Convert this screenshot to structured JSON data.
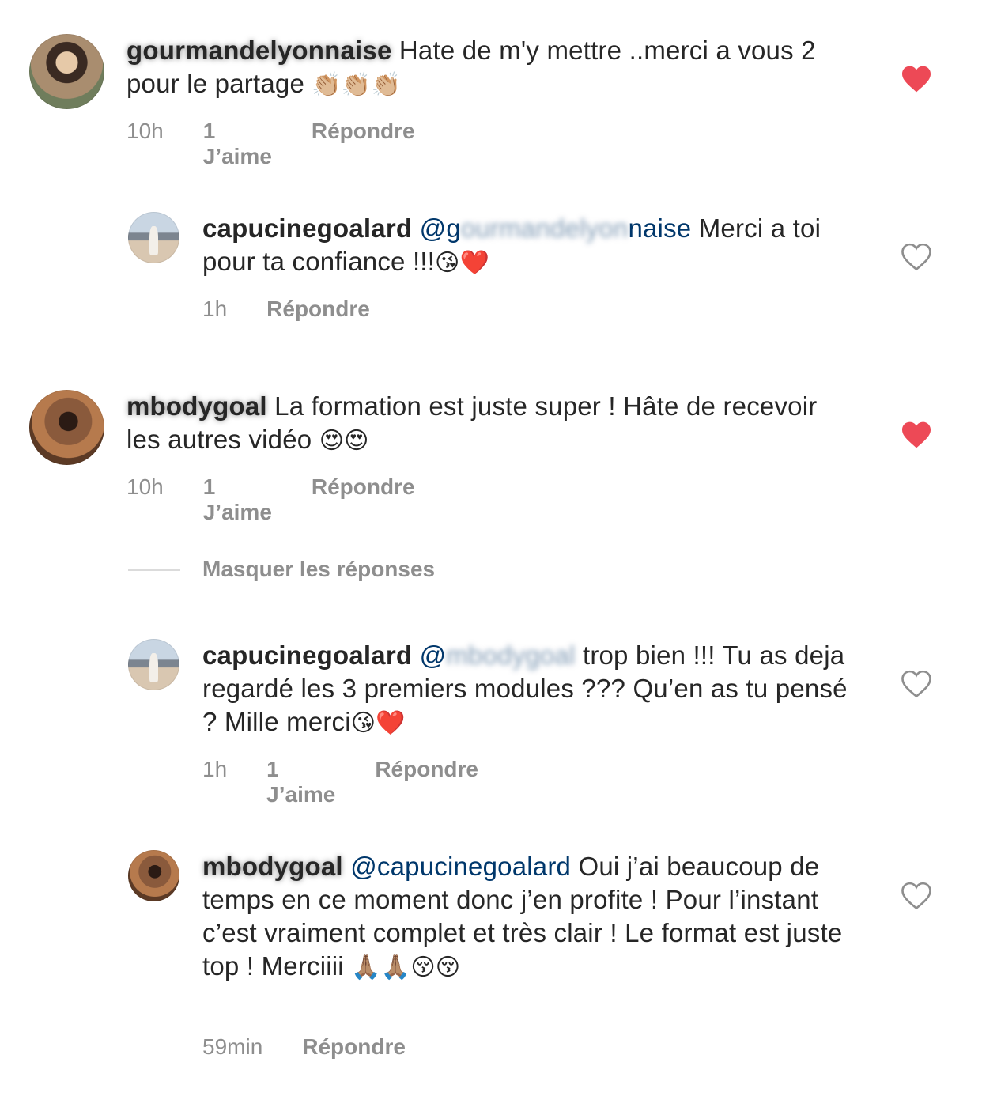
{
  "comments": [
    {
      "username": "gourmandelyonnaise",
      "text": " Hate de m'y mettre ..merci a vous 2 pour le partage ",
      "emojis": "👏🏼👏🏼👏🏼",
      "time": "10h",
      "likes": "1 J’aime",
      "reply": "Répondre",
      "liked": true
    },
    {
      "username": "capucinegoalard",
      "mention_prefix": "@g",
      "mention_hidden": "ourmandelyon",
      "mention_suffix": "naise",
      "text": " Merci a toi pour ta confiance !!!",
      "emojis": "😘❤️",
      "time": "1h",
      "reply": "Répondre",
      "liked": false
    },
    {
      "username": "mbodygoal",
      "text": " La formation est juste super ! Hâte de recevoir les autres vidéo ",
      "emojis": "😍😍",
      "time": "10h",
      "likes": "1 J’aime",
      "reply": "Répondre",
      "liked": true
    },
    {
      "username": "capucinegoalard",
      "mention_prefix": "@",
      "mention_hidden": "mbodygoal",
      "text": " trop bien !!! Tu as deja regardé les 3 premiers modules ??? Qu’en as tu pensé ? Mille merci",
      "emojis": "😘❤️",
      "time": "1h",
      "likes": "1 J’aime",
      "reply": "Répondre",
      "liked": false
    },
    {
      "username": "mbodygoal",
      "mention": "@capucinegoalard",
      "text": " Oui j’ai beaucoup de temps en ce moment donc j’en profite ! Pour l’instant c’est vraiment complet et très clair ! Le format est juste top ! Merciiii ",
      "emojis": "🙏🏽🙏🏽😚😚",
      "time": "59min",
      "reply": "Répondre",
      "liked": false
    }
  ],
  "hide_replies_label": "Masquer les réponses",
  "colors": {
    "liked_heart": "#ed4956",
    "outline_heart": "#8e8e8e",
    "mention": "#00376b",
    "meta": "#8e8e8e"
  }
}
